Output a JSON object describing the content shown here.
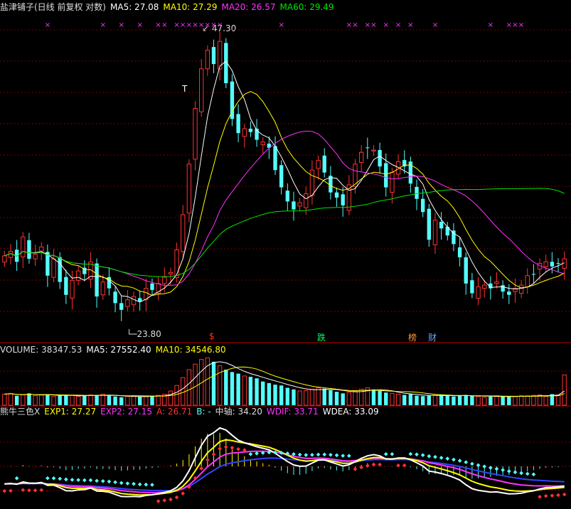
{
  "colors": {
    "up": "#ff3232",
    "down": "#54ffff",
    "ma5": "#ffffff",
    "ma10": "#ffff00",
    "ma20": "#ff32ff",
    "ma60": "#00e600",
    "exp1": "#ffff00",
    "exp2": "#ff32ff",
    "a": "#ff3232",
    "grid": "#7a0000",
    "divider": "#c00000"
  },
  "main_legend": {
    "title": "盐津铺子(日线 前复权 对数)",
    "ma5": "MA5: 27.08",
    "ma10": "MA10: 27.29",
    "ma20": "MA20: 26.57",
    "ma60": "MA60: 29.49"
  },
  "vol_legend": {
    "volume": "VOLUME: 38347.53",
    "ma5": "MA5: 27552.40",
    "ma10": "MA10: 34546.80"
  },
  "ind_legend": {
    "name": "熊牛三色X",
    "exp1": "EXP1: 27.27",
    "exp2": "EXP2: 27.15",
    "a": "A: 26.71",
    "b": "B: -",
    "axis": "中轴: 34.20",
    "wdif": "WDIF: 33.71",
    "wdea": "WDEA: 33.09"
  },
  "annotations": {
    "high": "47.30",
    "low": "23.80",
    "t_mark": "T",
    "x_mark": "×",
    "badges": [
      {
        "text": "$",
        "color": "#ff3232"
      },
      {
        "text": "跌",
        "color": "#00ff66"
      },
      {
        "text": "榜",
        "color": "#ff9933"
      },
      {
        "text": "财",
        "color": "#66aaff"
      }
    ]
  },
  "chart_data": {
    "type": "candlestick",
    "price_range": [
      22.5,
      49.5
    ],
    "high": 47.3,
    "low": 23.8,
    "close": [
      27.6,
      27.9,
      27.2,
      28.9,
      27.4,
      27.7,
      28.2,
      26.3,
      27.4,
      25.9,
      25.1,
      26.0,
      26.6,
      26.4,
      27.2,
      25.0,
      25.9,
      25.5,
      24.6,
      24.2,
      24.8,
      25.0,
      24.7,
      25.5,
      25.4,
      25.8,
      26.2,
      26.5,
      28.0,
      30.5,
      34.5,
      39.5,
      43.5,
      45.5,
      44.0,
      46.5,
      42.0,
      38.5,
      37.2,
      37.6,
      37.3,
      36.6,
      36.4,
      35.9,
      34.0,
      32.6,
      31.5,
      30.9,
      31.4,
      32.1,
      34.0,
      34.8,
      33.8,
      32.2,
      31.8,
      31.2,
      32.8,
      34.5,
      35.5,
      35.9,
      35.7,
      34.3,
      32.6,
      33.8,
      34.7,
      34.3,
      32.9,
      31.7,
      30.7,
      28.7,
      30.1,
      29.5,
      29.0,
      28.4,
      27.5,
      25.8,
      25.2,
      25.6,
      25.7,
      25.5,
      25.9,
      25.3,
      25.1,
      25.5,
      25.7,
      26.3,
      26.4,
      27.1,
      27.2,
      26.9,
      27.1,
      27.4
    ],
    "volume": [
      14000,
      15000,
      12000,
      13000,
      15000,
      12000,
      13000,
      14000,
      11000,
      12000,
      13000,
      12500,
      11000,
      12000,
      13000,
      13000,
      14000,
      12000,
      11000,
      10000,
      11000,
      12000,
      10500,
      11000,
      12000,
      12500,
      14000,
      18000,
      25000,
      35000,
      45000,
      52000,
      58000,
      60000,
      55000,
      50000,
      45000,
      42000,
      40000,
      37000,
      36000,
      34000,
      30000,
      28000,
      26000,
      25000,
      22000,
      20000,
      18000,
      18500,
      20000,
      22000,
      21000,
      19000,
      17000,
      15000,
      16000,
      18000,
      20000,
      22000,
      20000,
      18000,
      16000,
      15000,
      14000,
      13000,
      14000,
      12000,
      11500,
      12000,
      12500,
      13000,
      12000,
      11000,
      12000,
      13000,
      12000,
      11000,
      10000,
      11000,
      12000,
      11000,
      10500,
      11000,
      12000,
      12000,
      12500,
      13000,
      11000,
      14000,
      13000,
      38347.53
    ]
  }
}
